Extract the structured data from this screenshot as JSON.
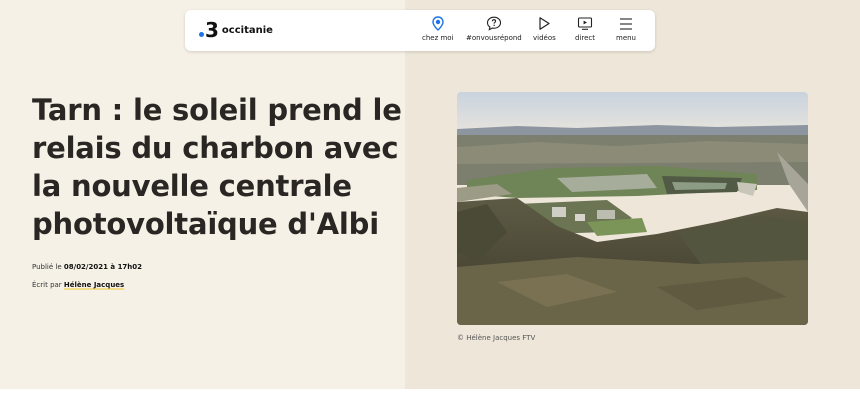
{
  "brand": {
    "number": "3",
    "name": "occitanie",
    "accent": "#1e73e8"
  },
  "nav": {
    "items": [
      {
        "label": "chez moi",
        "icon": "location-pin-icon"
      },
      {
        "label": "#onvousrépond",
        "icon": "question-bubble-icon"
      },
      {
        "label": "vidéos",
        "icon": "play-icon"
      },
      {
        "label": "direct",
        "icon": "live-tv-icon"
      },
      {
        "label": "menu",
        "icon": "hamburger-menu-icon"
      }
    ]
  },
  "article": {
    "title": "Tarn : le soleil prend le relais du charbon avec la nouvelle centrale photovoltaïque d'Albi",
    "published_prefix": "Publié le ",
    "published_value": "08/02/2021 à 17h02",
    "author_prefix": "Écrit par ",
    "author_name": "Hélène Jacques",
    "photo_caption": "© Hélène Jacques FTV"
  },
  "colors": {
    "hero_left_bg": "#f6f1e7",
    "hero_right_bg": "#ede6d9",
    "title_text": "#2a2623",
    "author_underline": "#f2dd8a"
  }
}
